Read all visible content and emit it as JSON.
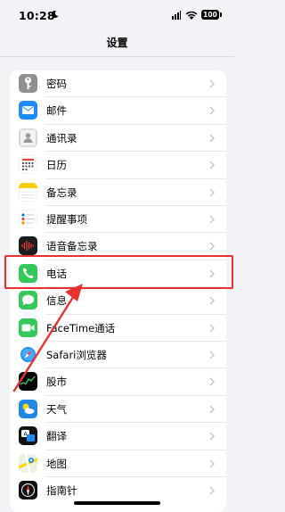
{
  "status_bar": {
    "time": "10:28",
    "battery": "100",
    "moon": "moon-icon",
    "wifi": "wifi-icon",
    "sim": "dual-sim-icon"
  },
  "header": {
    "title": "设置"
  },
  "settings": {
    "items": [
      {
        "label": "密码",
        "icon": "key-icon",
        "color": "#8e8e93"
      },
      {
        "label": "邮件",
        "icon": "mail-icon",
        "color": "#1a8cff"
      },
      {
        "label": "通讯录",
        "icon": "contacts-icon",
        "color": "#b7b7bb"
      },
      {
        "label": "日历",
        "icon": "calendar-icon",
        "color": "#ffffff"
      },
      {
        "label": "备忘录",
        "icon": "notes-icon",
        "color": "#ffd60a"
      },
      {
        "label": "提醒事项",
        "icon": "reminders-icon",
        "color": "#ffffff"
      },
      {
        "label": "语音备忘录",
        "icon": "voice-memos-icon",
        "color": "#1c1c1e"
      },
      {
        "label": "电话",
        "icon": "phone-icon",
        "color": "#34c759"
      },
      {
        "label": "信息",
        "icon": "messages-icon",
        "color": "#34c759"
      },
      {
        "label": "FaceTime通话",
        "icon": "facetime-icon",
        "color": "#34c759"
      },
      {
        "label": "Safari浏览器",
        "icon": "safari-icon",
        "color": "#1a8cff"
      },
      {
        "label": "股市",
        "icon": "stocks-icon",
        "color": "#000000"
      },
      {
        "label": "天气",
        "icon": "weather-icon",
        "color": "#1e88e5"
      },
      {
        "label": "翻译",
        "icon": "translate-icon",
        "color": "#111111"
      },
      {
        "label": "地图",
        "icon": "maps-icon",
        "color": "#e8f3e0"
      },
      {
        "label": "指南针",
        "icon": "compass-icon",
        "color": "#111111"
      }
    ]
  },
  "annotation": {
    "highlight_color": "#e8322f",
    "highlighted_item": "电话"
  }
}
